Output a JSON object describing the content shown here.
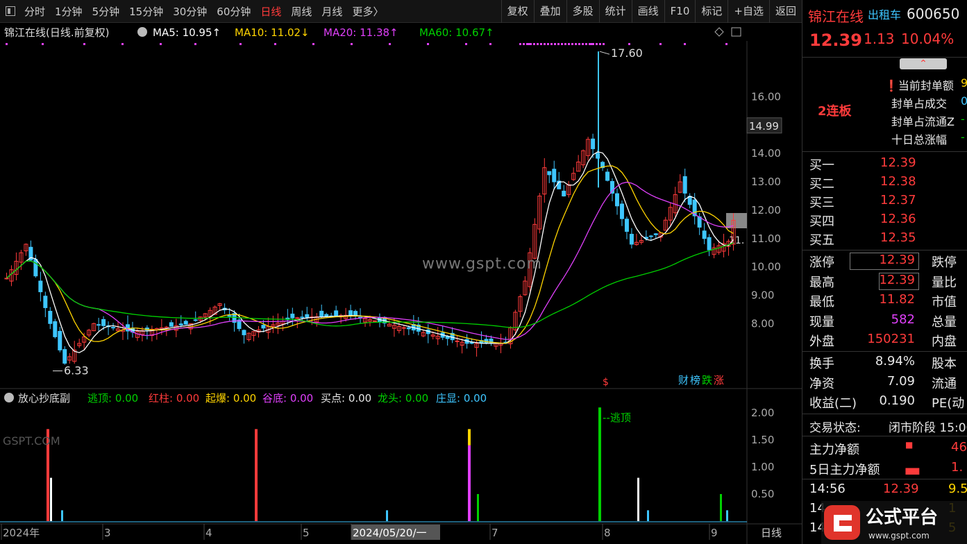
{
  "toolbar": {
    "tabs": [
      "分时",
      "1分钟",
      "5分钟",
      "15分钟",
      "30分钟",
      "60分钟",
      "日线",
      "周线",
      "月线",
      "更多〉"
    ],
    "active": "日线",
    "right": [
      "复权",
      "叠加",
      "多股",
      "统计",
      "画线",
      "F10",
      "标记",
      "+自选",
      "返回"
    ]
  },
  "chart": {
    "title": "锦江在线(日线.前复权)",
    "ma": [
      {
        "label": "MA5: 10.95↑",
        "color": "#ffffff"
      },
      {
        "label": "MA10: 11.02↓",
        "color": "#ffd400"
      },
      {
        "label": "MA20: 11.38↑",
        "color": "#e040fb"
      },
      {
        "label": "MA60: 10.67↑",
        "color": "#00d000"
      }
    ],
    "yticks": [
      "16.00",
      "15.00",
      "14.00",
      "13.00",
      "12.00",
      "11.00",
      "10.00",
      "9.00",
      "8.00"
    ],
    "high_label": "17.60",
    "low_label": "6.33",
    "current_tag": "14.99",
    "right_tag": "11.",
    "badges": [
      "财",
      "榜",
      "跌",
      "涨"
    ],
    "s_mark": "$"
  },
  "chart_data": {
    "type": "candlestick",
    "ylim": [
      6,
      17.8
    ],
    "high": 17.6,
    "low": 6.33,
    "ma": {
      "MA5": 10.95,
      "MA10": 11.02,
      "MA20": 11.38,
      "MA60": 10.67
    }
  },
  "indicator": {
    "title": "放心抄底副",
    "items": [
      {
        "label": "逃顶:",
        "value": "0.00",
        "color": "#00d000"
      },
      {
        "label": "红柱:",
        "value": "0.00",
        "color": "#ff3b3b"
      },
      {
        "label": "起爆:",
        "value": "0.00",
        "color": "#ffd400"
      },
      {
        "label": "谷底:",
        "value": "0.00",
        "color": "#e040fb"
      },
      {
        "label": "买点:",
        "value": "0.00",
        "color": "#e8e8e8"
      },
      {
        "label": "龙头:",
        "value": "0.00",
        "color": "#00d000"
      },
      {
        "label": "庄显:",
        "value": "0.00",
        "color": "#3ec6ff"
      }
    ],
    "yticks": [
      "2.00",
      "1.50",
      "1.00",
      "0.50"
    ],
    "annotation": "--逃顶"
  },
  "xaxis": {
    "labels": [
      "2024年",
      "3",
      "4",
      "5",
      "2024/05/20/一",
      "7",
      "8",
      "9"
    ],
    "period": "日线"
  },
  "watermark": "www.gspt.com",
  "watermark2": "GSPT.COM",
  "quote": {
    "name": "锦江在线",
    "tag": "出租车",
    "code": "600650",
    "price": "12.39",
    "change": "1.13",
    "pct": "10.04%"
  },
  "seal": {
    "label": "2连板",
    "rows": [
      {
        "k": "当前封单额",
        "v": "9"
      },
      {
        "k": "封单占成交",
        "v": "0"
      },
      {
        "k": "封单占流通Z",
        "v": "-"
      },
      {
        "k": "十日总涨幅",
        "v": "-"
      }
    ]
  },
  "orderbook": [
    {
      "k": "买一",
      "v": "12.39"
    },
    {
      "k": "买二",
      "v": "12.38"
    },
    {
      "k": "买三",
      "v": "12.37"
    },
    {
      "k": "买四",
      "v": "12.36"
    },
    {
      "k": "买五",
      "v": "12.35"
    }
  ],
  "stats": [
    {
      "k": "涨停",
      "v": "12.39",
      "k2": "跌停",
      "vc": "#ff3b3b"
    },
    {
      "k": "最高",
      "v": "12.39",
      "k2": "量比",
      "vc": "#ff3b3b"
    },
    {
      "k": "最低",
      "v": "11.82",
      "k2": "市值",
      "vc": "#ff3b3b"
    },
    {
      "k": "现量",
      "v": "582",
      "k2": "总量",
      "vc": "#e040fb"
    },
    {
      "k": "外盘",
      "v": "150231",
      "k2": "内盘",
      "vc": "#ff3b3b"
    }
  ],
  "stats2": [
    {
      "k": "换手",
      "v": "8.94%",
      "k2": "股本"
    },
    {
      "k": "净资",
      "v": "7.09",
      "k2": "流通"
    },
    {
      "k": "收益(二)",
      "v": "0.190",
      "k2": "PE(动"
    }
  ],
  "status": {
    "label": "交易状态:",
    "value": "闭市阶段 15:00"
  },
  "flow": [
    {
      "k": "主力净额",
      "v": "46"
    },
    {
      "k": "5日主力净额",
      "v": "1."
    }
  ],
  "ticks": [
    {
      "t": "14:56",
      "p": "12.39",
      "v": "9.5"
    },
    {
      "t": "14",
      "p": "",
      "v": "1"
    },
    {
      "t": "14",
      "p": "",
      "v": "5"
    }
  ],
  "brand": {
    "name": "公式平台",
    "url": "www.gspt.com"
  }
}
